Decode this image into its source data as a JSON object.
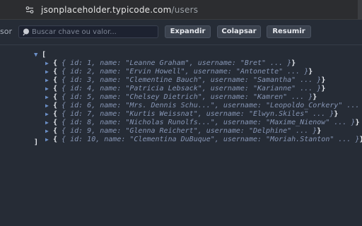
{
  "browser": {
    "url_host": "jsonplaceholder.typicode.com",
    "url_path": "/users"
  },
  "toolbar": {
    "edge_label": "sor",
    "search_placeholder": "Buscar chave ou valor...",
    "expand_label": "Expandir",
    "collapse_label": "Colapsar",
    "summary_label": "Resumir"
  },
  "tree": {
    "open_bracket": "[",
    "close_bracket": "]",
    "expand_arrow": "▼",
    "collapsed_arrow": "▶",
    "items": [
      {
        "open": "{",
        "summary": " { id: 1, name: \"Leanne Graham\", username: \"Bret\" ... }",
        "close": "}"
      },
      {
        "open": "{",
        "summary": " { id: 2, name: \"Ervin Howell\", username: \"Antonette\" ... }",
        "close": "}"
      },
      {
        "open": "{",
        "summary": " { id: 3, name: \"Clementine Bauch\", username: \"Samantha\" ... }",
        "close": "}"
      },
      {
        "open": "{",
        "summary": " { id: 4, name: \"Patricia Lebsack\", username: \"Karianne\" ... }",
        "close": "}"
      },
      {
        "open": "{",
        "summary": " { id: 5, name: \"Chelsey Dietrich\", username: \"Kamren\" ... }",
        "close": "}"
      },
      {
        "open": "{",
        "summary": " { id: 6, name: \"Mrs. Dennis Schu...\", username: \"Leopoldo_Corkery\" ... }",
        "close": "}"
      },
      {
        "open": "{",
        "summary": " { id: 7, name: \"Kurtis Weissnat\", username: \"Elwyn.Skiles\" ... }",
        "close": "}"
      },
      {
        "open": "{",
        "summary": " { id: 8, name: \"Nicholas Runolfs...\", username: \"Maxime_Nienow\" ... }",
        "close": "}"
      },
      {
        "open": "{",
        "summary": " { id: 9, name: \"Glenna Reichert\", username: \"Delphine\" ... }",
        "close": "}"
      },
      {
        "open": "{",
        "summary": " { id: 10, name: \"Clementina DuBuque\", username: \"Moriah.Stanton\" ... }",
        "close": "}"
      }
    ]
  }
}
